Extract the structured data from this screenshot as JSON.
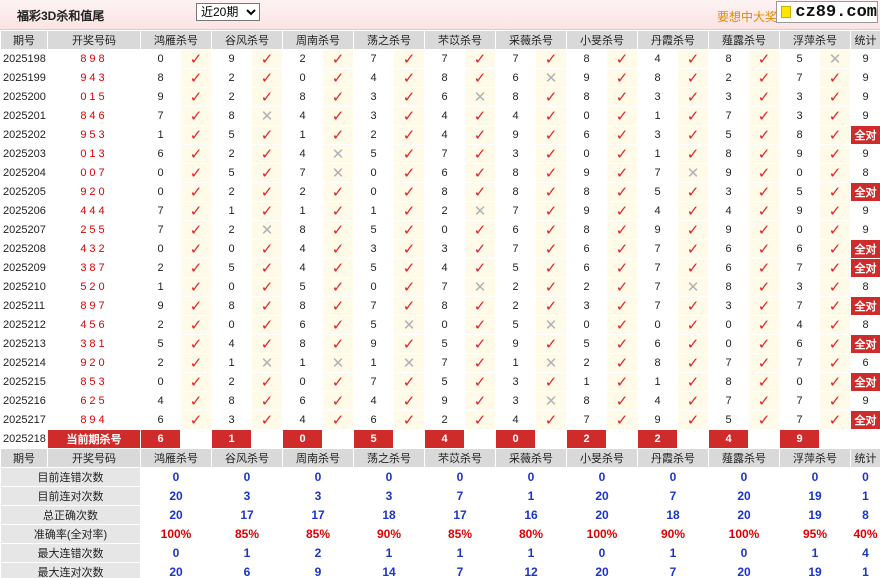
{
  "header": {
    "title": "福彩3D杀和值尾",
    "period_selected": "近20期",
    "period_options": [
      "近20期"
    ],
    "promo": "要想中大奖",
    "logo": "cz89.com"
  },
  "columns": {
    "period": "期号",
    "draw": "开奖号码",
    "experts": [
      "鸿雁杀号",
      "谷风杀号",
      "周南杀号",
      "荡之杀号",
      "芣苡杀号",
      "采薇杀号",
      "小旻杀号",
      "丹霞杀号",
      "薤露杀号",
      "浮萍杀号"
    ],
    "stats": "统计"
  },
  "rows": [
    {
      "period": "2025198",
      "draw": "898",
      "picks": [
        [
          0,
          1
        ],
        [
          9,
          1
        ],
        [
          2,
          1
        ],
        [
          7,
          1
        ],
        [
          7,
          1
        ],
        [
          7,
          1
        ],
        [
          8,
          1
        ],
        [
          4,
          1
        ],
        [
          8,
          1
        ],
        [
          5,
          0
        ]
      ],
      "stat": "9"
    },
    {
      "period": "2025199",
      "draw": "943",
      "picks": [
        [
          8,
          1
        ],
        [
          2,
          1
        ],
        [
          0,
          1
        ],
        [
          4,
          1
        ],
        [
          8,
          1
        ],
        [
          6,
          0
        ],
        [
          9,
          1
        ],
        [
          8,
          1
        ],
        [
          2,
          1
        ],
        [
          7,
          1
        ]
      ],
      "stat": "9"
    },
    {
      "period": "2025200",
      "draw": "015",
      "picks": [
        [
          9,
          1
        ],
        [
          2,
          1
        ],
        [
          8,
          1
        ],
        [
          3,
          1
        ],
        [
          6,
          0
        ],
        [
          8,
          1
        ],
        [
          8,
          1
        ],
        [
          3,
          1
        ],
        [
          3,
          1
        ],
        [
          3,
          1
        ]
      ],
      "stat": "9"
    },
    {
      "period": "2025201",
      "draw": "846",
      "picks": [
        [
          7,
          1
        ],
        [
          8,
          0
        ],
        [
          4,
          1
        ],
        [
          3,
          1
        ],
        [
          4,
          1
        ],
        [
          4,
          1
        ],
        [
          0,
          1
        ],
        [
          1,
          1
        ],
        [
          7,
          1
        ],
        [
          3,
          1
        ]
      ],
      "stat": "9"
    },
    {
      "period": "2025202",
      "draw": "953",
      "picks": [
        [
          1,
          1
        ],
        [
          5,
          1
        ],
        [
          1,
          1
        ],
        [
          2,
          1
        ],
        [
          4,
          1
        ],
        [
          9,
          1
        ],
        [
          6,
          1
        ],
        [
          3,
          1
        ],
        [
          5,
          1
        ],
        [
          8,
          1
        ]
      ],
      "stat": "全对"
    },
    {
      "period": "2025203",
      "draw": "013",
      "picks": [
        [
          6,
          1
        ],
        [
          2,
          1
        ],
        [
          4,
          0
        ],
        [
          5,
          1
        ],
        [
          7,
          1
        ],
        [
          3,
          1
        ],
        [
          0,
          1
        ],
        [
          1,
          1
        ],
        [
          8,
          1
        ],
        [
          9,
          1
        ]
      ],
      "stat": "9"
    },
    {
      "period": "2025204",
      "draw": "007",
      "picks": [
        [
          0,
          1
        ],
        [
          5,
          1
        ],
        [
          7,
          0
        ],
        [
          0,
          1
        ],
        [
          6,
          1
        ],
        [
          8,
          1
        ],
        [
          9,
          1
        ],
        [
          7,
          0
        ],
        [
          9,
          1
        ],
        [
          0,
          1
        ]
      ],
      "stat": "8"
    },
    {
      "period": "2025205",
      "draw": "920",
      "picks": [
        [
          0,
          1
        ],
        [
          2,
          1
        ],
        [
          2,
          1
        ],
        [
          0,
          1
        ],
        [
          8,
          1
        ],
        [
          8,
          1
        ],
        [
          8,
          1
        ],
        [
          5,
          1
        ],
        [
          3,
          1
        ],
        [
          5,
          1
        ]
      ],
      "stat": "全对"
    },
    {
      "period": "2025206",
      "draw": "444",
      "picks": [
        [
          7,
          1
        ],
        [
          1,
          1
        ],
        [
          1,
          1
        ],
        [
          1,
          1
        ],
        [
          2,
          0
        ],
        [
          7,
          1
        ],
        [
          9,
          1
        ],
        [
          4,
          1
        ],
        [
          4,
          1
        ],
        [
          9,
          1
        ]
      ],
      "stat": "9"
    },
    {
      "period": "2025207",
      "draw": "255",
      "picks": [
        [
          7,
          1
        ],
        [
          2,
          0
        ],
        [
          8,
          1
        ],
        [
          5,
          1
        ],
        [
          0,
          1
        ],
        [
          6,
          1
        ],
        [
          8,
          1
        ],
        [
          9,
          1
        ],
        [
          9,
          1
        ],
        [
          0,
          1
        ]
      ],
      "stat": "9"
    },
    {
      "period": "2025208",
      "draw": "432",
      "picks": [
        [
          0,
          1
        ],
        [
          0,
          1
        ],
        [
          4,
          1
        ],
        [
          3,
          1
        ],
        [
          3,
          1
        ],
        [
          7,
          1
        ],
        [
          6,
          1
        ],
        [
          7,
          1
        ],
        [
          6,
          1
        ],
        [
          6,
          1
        ]
      ],
      "stat": "全对"
    },
    {
      "period": "2025209",
      "draw": "387",
      "picks": [
        [
          2,
          1
        ],
        [
          5,
          1
        ],
        [
          4,
          1
        ],
        [
          5,
          1
        ],
        [
          4,
          1
        ],
        [
          5,
          1
        ],
        [
          6,
          1
        ],
        [
          7,
          1
        ],
        [
          6,
          1
        ],
        [
          7,
          1
        ]
      ],
      "stat": "全对"
    },
    {
      "period": "2025210",
      "draw": "520",
      "picks": [
        [
          1,
          1
        ],
        [
          0,
          1
        ],
        [
          5,
          1
        ],
        [
          0,
          1
        ],
        [
          7,
          0
        ],
        [
          2,
          1
        ],
        [
          2,
          1
        ],
        [
          7,
          0
        ],
        [
          8,
          1
        ],
        [
          3,
          1
        ]
      ],
      "stat": "8"
    },
    {
      "period": "2025211",
      "draw": "897",
      "picks": [
        [
          9,
          1
        ],
        [
          8,
          1
        ],
        [
          8,
          1
        ],
        [
          7,
          1
        ],
        [
          8,
          1
        ],
        [
          2,
          1
        ],
        [
          3,
          1
        ],
        [
          7,
          1
        ],
        [
          3,
          1
        ],
        [
          7,
          1
        ]
      ],
      "stat": "全对"
    },
    {
      "period": "2025212",
      "draw": "456",
      "picks": [
        [
          2,
          1
        ],
        [
          0,
          1
        ],
        [
          6,
          1
        ],
        [
          5,
          0
        ],
        [
          0,
          1
        ],
        [
          5,
          0
        ],
        [
          0,
          1
        ],
        [
          0,
          1
        ],
        [
          0,
          1
        ],
        [
          4,
          1
        ]
      ],
      "stat": "8"
    },
    {
      "period": "2025213",
      "draw": "381",
      "picks": [
        [
          5,
          1
        ],
        [
          4,
          1
        ],
        [
          8,
          1
        ],
        [
          9,
          1
        ],
        [
          5,
          1
        ],
        [
          9,
          1
        ],
        [
          5,
          1
        ],
        [
          6,
          1
        ],
        [
          0,
          1
        ],
        [
          6,
          1
        ]
      ],
      "stat": "全对"
    },
    {
      "period": "2025214",
      "draw": "920",
      "picks": [
        [
          2,
          1
        ],
        [
          1,
          0
        ],
        [
          1,
          0
        ],
        [
          1,
          0
        ],
        [
          7,
          1
        ],
        [
          1,
          0
        ],
        [
          2,
          1
        ],
        [
          8,
          1
        ],
        [
          7,
          1
        ],
        [
          7,
          1
        ]
      ],
      "stat": "6"
    },
    {
      "period": "2025215",
      "draw": "853",
      "picks": [
        [
          0,
          1
        ],
        [
          2,
          1
        ],
        [
          0,
          1
        ],
        [
          7,
          1
        ],
        [
          5,
          1
        ],
        [
          3,
          1
        ],
        [
          1,
          1
        ],
        [
          1,
          1
        ],
        [
          8,
          1
        ],
        [
          0,
          1
        ]
      ],
      "stat": "全对"
    },
    {
      "period": "2025216",
      "draw": "625",
      "picks": [
        [
          4,
          1
        ],
        [
          8,
          1
        ],
        [
          6,
          1
        ],
        [
          4,
          1
        ],
        [
          9,
          1
        ],
        [
          3,
          0
        ],
        [
          8,
          1
        ],
        [
          4,
          1
        ],
        [
          7,
          1
        ],
        [
          7,
          1
        ]
      ],
      "stat": "9"
    },
    {
      "period": "2025217",
      "draw": "894",
      "picks": [
        [
          6,
          1
        ],
        [
          3,
          1
        ],
        [
          4,
          1
        ],
        [
          6,
          1
        ],
        [
          2,
          1
        ],
        [
          4,
          1
        ],
        [
          7,
          1
        ],
        [
          9,
          1
        ],
        [
          5,
          1
        ],
        [
          7,
          1
        ]
      ],
      "stat": "全对"
    }
  ],
  "current": {
    "period": "2025218",
    "label": "当前期杀号",
    "picks": [
      "6",
      "1",
      "0",
      "5",
      "4",
      "0",
      "2",
      "2",
      "4",
      "9"
    ]
  },
  "summary": [
    {
      "label": "目前连错次数",
      "values": [
        "0",
        "0",
        "0",
        "0",
        "0",
        "0",
        "0",
        "0",
        "0",
        "0"
      ],
      "stat": "0",
      "pct": false
    },
    {
      "label": "目前连对次数",
      "values": [
        "20",
        "3",
        "3",
        "3",
        "7",
        "1",
        "20",
        "7",
        "20",
        "19"
      ],
      "stat": "1",
      "pct": false
    },
    {
      "label": "总正确次数",
      "values": [
        "20",
        "17",
        "17",
        "18",
        "17",
        "16",
        "20",
        "18",
        "20",
        "19"
      ],
      "stat": "8",
      "pct": false
    },
    {
      "label": "准确率(全对率)",
      "values": [
        "100%",
        "85%",
        "85%",
        "90%",
        "85%",
        "80%",
        "100%",
        "90%",
        "100%",
        "95%"
      ],
      "stat": "40%",
      "pct": true
    },
    {
      "label": "最大连错次数",
      "values": [
        "0",
        "1",
        "2",
        "1",
        "1",
        "1",
        "0",
        "1",
        "0",
        "1"
      ],
      "stat": "4",
      "pct": false
    },
    {
      "label": "最大连对次数",
      "values": [
        "20",
        "6",
        "9",
        "14",
        "7",
        "12",
        "20",
        "7",
        "20",
        "19"
      ],
      "stat": "1",
      "pct": false
    }
  ],
  "symbols": {
    "correct": "✓",
    "wrong": "✕"
  },
  "colors": {
    "correct": "#e0242e",
    "wrong": "#b0b0b8",
    "highlight": "#cf2b2b",
    "stat_blue": "#1a35c9"
  }
}
